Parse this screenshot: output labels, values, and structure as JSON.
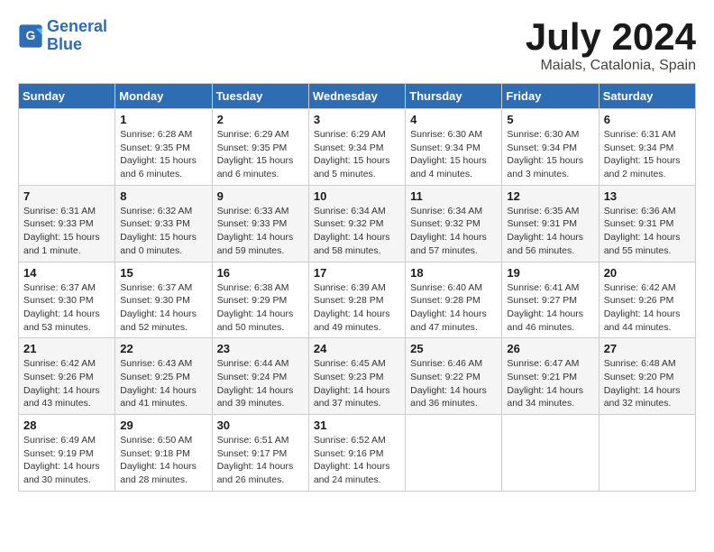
{
  "header": {
    "logo_line1": "General",
    "logo_line2": "Blue",
    "month": "July 2024",
    "location": "Maials, Catalonia, Spain"
  },
  "weekdays": [
    "Sunday",
    "Monday",
    "Tuesday",
    "Wednesday",
    "Thursday",
    "Friday",
    "Saturday"
  ],
  "weeks": [
    [
      {
        "day": "",
        "sunrise": "",
        "sunset": "",
        "daylight": ""
      },
      {
        "day": "1",
        "sunrise": "Sunrise: 6:28 AM",
        "sunset": "Sunset: 9:35 PM",
        "daylight": "Daylight: 15 hours and 6 minutes."
      },
      {
        "day": "2",
        "sunrise": "Sunrise: 6:29 AM",
        "sunset": "Sunset: 9:35 PM",
        "daylight": "Daylight: 15 hours and 6 minutes."
      },
      {
        "day": "3",
        "sunrise": "Sunrise: 6:29 AM",
        "sunset": "Sunset: 9:34 PM",
        "daylight": "Daylight: 15 hours and 5 minutes."
      },
      {
        "day": "4",
        "sunrise": "Sunrise: 6:30 AM",
        "sunset": "Sunset: 9:34 PM",
        "daylight": "Daylight: 15 hours and 4 minutes."
      },
      {
        "day": "5",
        "sunrise": "Sunrise: 6:30 AM",
        "sunset": "Sunset: 9:34 PM",
        "daylight": "Daylight: 15 hours and 3 minutes."
      },
      {
        "day": "6",
        "sunrise": "Sunrise: 6:31 AM",
        "sunset": "Sunset: 9:34 PM",
        "daylight": "Daylight: 15 hours and 2 minutes."
      }
    ],
    [
      {
        "day": "7",
        "sunrise": "Sunrise: 6:31 AM",
        "sunset": "Sunset: 9:33 PM",
        "daylight": "Daylight: 15 hours and 1 minute."
      },
      {
        "day": "8",
        "sunrise": "Sunrise: 6:32 AM",
        "sunset": "Sunset: 9:33 PM",
        "daylight": "Daylight: 15 hours and 0 minutes."
      },
      {
        "day": "9",
        "sunrise": "Sunrise: 6:33 AM",
        "sunset": "Sunset: 9:33 PM",
        "daylight": "Daylight: 14 hours and 59 minutes."
      },
      {
        "day": "10",
        "sunrise": "Sunrise: 6:34 AM",
        "sunset": "Sunset: 9:32 PM",
        "daylight": "Daylight: 14 hours and 58 minutes."
      },
      {
        "day": "11",
        "sunrise": "Sunrise: 6:34 AM",
        "sunset": "Sunset: 9:32 PM",
        "daylight": "Daylight: 14 hours and 57 minutes."
      },
      {
        "day": "12",
        "sunrise": "Sunrise: 6:35 AM",
        "sunset": "Sunset: 9:31 PM",
        "daylight": "Daylight: 14 hours and 56 minutes."
      },
      {
        "day": "13",
        "sunrise": "Sunrise: 6:36 AM",
        "sunset": "Sunset: 9:31 PM",
        "daylight": "Daylight: 14 hours and 55 minutes."
      }
    ],
    [
      {
        "day": "14",
        "sunrise": "Sunrise: 6:37 AM",
        "sunset": "Sunset: 9:30 PM",
        "daylight": "Daylight: 14 hours and 53 minutes."
      },
      {
        "day": "15",
        "sunrise": "Sunrise: 6:37 AM",
        "sunset": "Sunset: 9:30 PM",
        "daylight": "Daylight: 14 hours and 52 minutes."
      },
      {
        "day": "16",
        "sunrise": "Sunrise: 6:38 AM",
        "sunset": "Sunset: 9:29 PM",
        "daylight": "Daylight: 14 hours and 50 minutes."
      },
      {
        "day": "17",
        "sunrise": "Sunrise: 6:39 AM",
        "sunset": "Sunset: 9:28 PM",
        "daylight": "Daylight: 14 hours and 49 minutes."
      },
      {
        "day": "18",
        "sunrise": "Sunrise: 6:40 AM",
        "sunset": "Sunset: 9:28 PM",
        "daylight": "Daylight: 14 hours and 47 minutes."
      },
      {
        "day": "19",
        "sunrise": "Sunrise: 6:41 AM",
        "sunset": "Sunset: 9:27 PM",
        "daylight": "Daylight: 14 hours and 46 minutes."
      },
      {
        "day": "20",
        "sunrise": "Sunrise: 6:42 AM",
        "sunset": "Sunset: 9:26 PM",
        "daylight": "Daylight: 14 hours and 44 minutes."
      }
    ],
    [
      {
        "day": "21",
        "sunrise": "Sunrise: 6:42 AM",
        "sunset": "Sunset: 9:26 PM",
        "daylight": "Daylight: 14 hours and 43 minutes."
      },
      {
        "day": "22",
        "sunrise": "Sunrise: 6:43 AM",
        "sunset": "Sunset: 9:25 PM",
        "daylight": "Daylight: 14 hours and 41 minutes."
      },
      {
        "day": "23",
        "sunrise": "Sunrise: 6:44 AM",
        "sunset": "Sunset: 9:24 PM",
        "daylight": "Daylight: 14 hours and 39 minutes."
      },
      {
        "day": "24",
        "sunrise": "Sunrise: 6:45 AM",
        "sunset": "Sunset: 9:23 PM",
        "daylight": "Daylight: 14 hours and 37 minutes."
      },
      {
        "day": "25",
        "sunrise": "Sunrise: 6:46 AM",
        "sunset": "Sunset: 9:22 PM",
        "daylight": "Daylight: 14 hours and 36 minutes."
      },
      {
        "day": "26",
        "sunrise": "Sunrise: 6:47 AM",
        "sunset": "Sunset: 9:21 PM",
        "daylight": "Daylight: 14 hours and 34 minutes."
      },
      {
        "day": "27",
        "sunrise": "Sunrise: 6:48 AM",
        "sunset": "Sunset: 9:20 PM",
        "daylight": "Daylight: 14 hours and 32 minutes."
      }
    ],
    [
      {
        "day": "28",
        "sunrise": "Sunrise: 6:49 AM",
        "sunset": "Sunset: 9:19 PM",
        "daylight": "Daylight: 14 hours and 30 minutes."
      },
      {
        "day": "29",
        "sunrise": "Sunrise: 6:50 AM",
        "sunset": "Sunset: 9:18 PM",
        "daylight": "Daylight: 14 hours and 28 minutes."
      },
      {
        "day": "30",
        "sunrise": "Sunrise: 6:51 AM",
        "sunset": "Sunset: 9:17 PM",
        "daylight": "Daylight: 14 hours and 26 minutes."
      },
      {
        "day": "31",
        "sunrise": "Sunrise: 6:52 AM",
        "sunset": "Sunset: 9:16 PM",
        "daylight": "Daylight: 14 hours and 24 minutes."
      },
      {
        "day": "",
        "sunrise": "",
        "sunset": "",
        "daylight": ""
      },
      {
        "day": "",
        "sunrise": "",
        "sunset": "",
        "daylight": ""
      },
      {
        "day": "",
        "sunrise": "",
        "sunset": "",
        "daylight": ""
      }
    ]
  ]
}
